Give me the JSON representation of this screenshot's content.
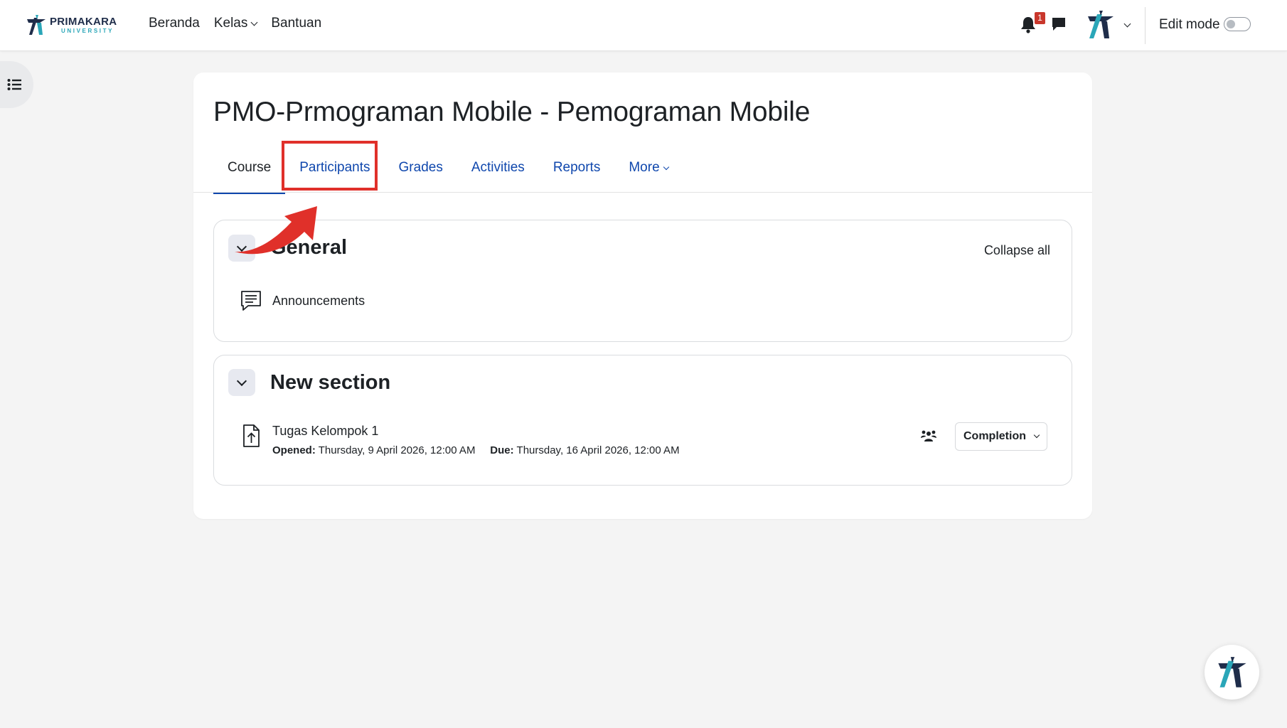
{
  "navbar": {
    "brand_name": "PRIMAKARA",
    "brand_sub": "UNIVERSITY",
    "links": [
      {
        "label": "Beranda",
        "has_menu": false
      },
      {
        "label": "Kelas",
        "has_menu": true
      },
      {
        "label": "Bantuan",
        "has_menu": false
      }
    ],
    "notification_count": "1",
    "edit_mode_label": "Edit mode",
    "edit_mode_on": false
  },
  "course": {
    "title": "PMO-Prmograman Mobile - Pemograman Mobile",
    "tabs": [
      {
        "label": "Course",
        "active": true
      },
      {
        "label": "Participants",
        "active": false,
        "highlighted": true
      },
      {
        "label": "Grades",
        "active": false
      },
      {
        "label": "Activities",
        "active": false
      },
      {
        "label": "Reports",
        "active": false
      },
      {
        "label": "More",
        "active": false,
        "has_menu": true
      }
    ],
    "collapse_all_label": "Collapse all",
    "sections": [
      {
        "title": "General",
        "activities": [
          {
            "name": "Announcements",
            "type": "forum"
          }
        ]
      },
      {
        "title": "New section",
        "activities": [
          {
            "name": "Tugas Kelompok 1",
            "type": "assignment",
            "opened_label": "Opened:",
            "opened_value": "Thursday, 9 April 2026, 12:00 AM",
            "due_label": "Due:",
            "due_value": "Thursday, 16 April 2026, 12:00 AM",
            "completion_label": "Completion"
          }
        ]
      }
    ]
  },
  "colors": {
    "accent": "#0f47ad",
    "highlight": "#e0302a",
    "brand_dark": "#1f2d4a",
    "brand_teal": "#2aa6b8"
  },
  "icons": {
    "drawer": "list-icon",
    "notifications": "bell-icon",
    "messages": "chat-icon",
    "forum": "forum-icon",
    "assignment": "file-upload-icon",
    "groups": "group-icon"
  }
}
